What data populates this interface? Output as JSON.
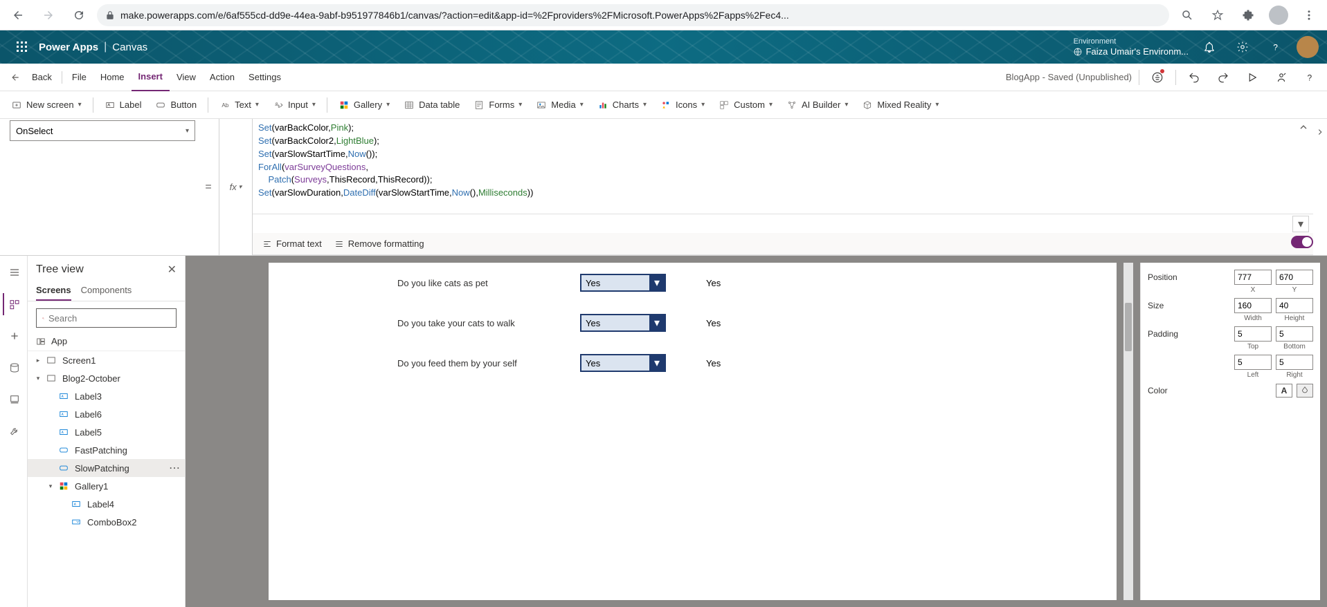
{
  "browser": {
    "url": "make.powerapps.com/e/6af555cd-dd9e-44ea-9abf-b951977846b1/canvas/?action=edit&app-id=%2Fproviders%2FMicrosoft.PowerApps%2Fapps%2Fec4..."
  },
  "header": {
    "product": "Power Apps",
    "page": "Canvas",
    "env_label": "Environment",
    "env_name": "Faiza Umair's Environm..."
  },
  "menu": {
    "back": "Back",
    "items": [
      "File",
      "Home",
      "Insert",
      "View",
      "Action",
      "Settings"
    ],
    "active": "Insert",
    "status": "BlogApp - Saved (Unpublished)"
  },
  "ribbon": {
    "new_screen": "New screen",
    "label": "Label",
    "button": "Button",
    "text": "Text",
    "input": "Input",
    "gallery": "Gallery",
    "data_table": "Data table",
    "forms": "Forms",
    "media": "Media",
    "charts": "Charts",
    "icons": "Icons",
    "custom": "Custom",
    "ai_builder": "AI Builder",
    "mixed_reality": "Mixed Reality"
  },
  "formula_bar": {
    "property": "OnSelect",
    "format_text": "Format text",
    "remove_formatting": "Remove formatting"
  },
  "chart_data": {},
  "formula_lines": [
    [
      [
        "fn",
        "Set"
      ],
      [
        "plain",
        "("
      ],
      [
        "plain",
        "varBackColor"
      ],
      [
        "plain",
        ","
      ],
      [
        "opt",
        "Pink"
      ],
      [
        "plain",
        ");"
      ]
    ],
    [
      [
        "fn",
        "Set"
      ],
      [
        "plain",
        "("
      ],
      [
        "plain",
        "varBackColor2"
      ],
      [
        "plain",
        ","
      ],
      [
        "opt",
        "LightBlue"
      ],
      [
        "plain",
        ");"
      ]
    ],
    [
      [
        "fn",
        "Set"
      ],
      [
        "plain",
        "("
      ],
      [
        "plain",
        "varSlowStartTime"
      ],
      [
        "plain",
        ","
      ],
      [
        "fn",
        "Now"
      ],
      [
        "plain",
        "());"
      ]
    ],
    [
      [
        "fn",
        "ForAll"
      ],
      [
        "plain",
        "("
      ],
      [
        "var",
        "varSurveyQuestions"
      ],
      [
        "plain",
        ","
      ]
    ],
    [
      [
        "plain",
        "    "
      ],
      [
        "fn",
        "Patch"
      ],
      [
        "plain",
        "("
      ],
      [
        "var",
        "Surveys"
      ],
      [
        "plain",
        ",ThisRecord,ThisRecord));"
      ]
    ],
    [
      [
        "fn",
        "Set"
      ],
      [
        "plain",
        "("
      ],
      [
        "plain",
        "varSlowDuration"
      ],
      [
        "plain",
        ","
      ],
      [
        "fn",
        "DateDiff"
      ],
      [
        "plain",
        "(varSlowStartTime,"
      ],
      [
        "fn",
        "Now"
      ],
      [
        "plain",
        "(),"
      ],
      [
        "opt",
        "Milliseconds"
      ],
      [
        "plain",
        "))"
      ]
    ]
  ],
  "tree": {
    "title": "Tree view",
    "tabs": [
      "Screens",
      "Components"
    ],
    "active_tab": "Screens",
    "search_placeholder": "Search",
    "app_label": "App",
    "items": [
      {
        "name": "Screen1",
        "type": "screen",
        "depth": 0,
        "expand": "collapsed"
      },
      {
        "name": "Blog2-October",
        "type": "screen",
        "depth": 0,
        "expand": "expanded"
      },
      {
        "name": "Label3",
        "type": "label",
        "depth": 1
      },
      {
        "name": "Label6",
        "type": "label",
        "depth": 1
      },
      {
        "name": "Label5",
        "type": "label",
        "depth": 1
      },
      {
        "name": "FastPatching",
        "type": "button",
        "depth": 1
      },
      {
        "name": "SlowPatching",
        "type": "button",
        "depth": 1,
        "selected": true
      },
      {
        "name": "Gallery1",
        "type": "gallery",
        "depth": 1,
        "expand": "expanded"
      },
      {
        "name": "Label4",
        "type": "label",
        "depth": 2
      },
      {
        "name": "ComboBox2",
        "type": "combo",
        "depth": 2
      }
    ]
  },
  "survey": [
    {
      "q": "Do you like cats as pet",
      "dd": "Yes",
      "ans": "Yes"
    },
    {
      "q": "Do you take your cats to walk",
      "dd": "Yes",
      "ans": "Yes"
    },
    {
      "q": "Do you feed them by your self",
      "dd": "Yes",
      "ans": "Yes"
    }
  ],
  "props": {
    "position_label": "Position",
    "pos_x": "777",
    "pos_y": "670",
    "x": "X",
    "y": "Y",
    "size_label": "Size",
    "width": "160",
    "height": "40",
    "w": "Width",
    "h": "Height",
    "padding_label": "Padding",
    "top": "5",
    "bottom": "5",
    "left": "5",
    "right": "5",
    "t": "Top",
    "b": "Bottom",
    "l": "Left",
    "r": "Right",
    "color_label": "Color",
    "color_letter": "A"
  }
}
